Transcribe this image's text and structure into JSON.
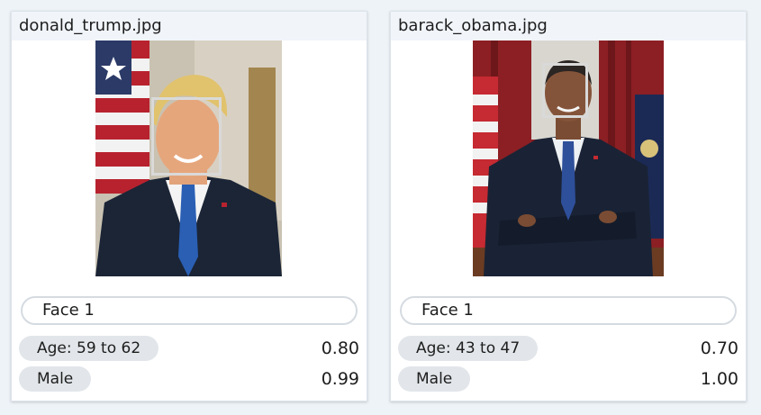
{
  "cards": [
    {
      "filename": "donald_trump.jpg",
      "face_label": "Face 1",
      "age_label": "Age: 59 to 62",
      "age_score": "0.80",
      "gender_label": "Male",
      "gender_score": "0.99"
    },
    {
      "filename": "barack_obama.jpg",
      "face_label": "Face 1",
      "age_label": "Age: 43 to 47",
      "age_score": "0.70",
      "gender_label": "Male",
      "gender_score": "1.00"
    }
  ],
  "colors": {
    "page_background": "#eef3f8",
    "card_header": "#f1f5fa",
    "tag_background": "#e2e6ea",
    "face_box": "#d9d9d9"
  }
}
